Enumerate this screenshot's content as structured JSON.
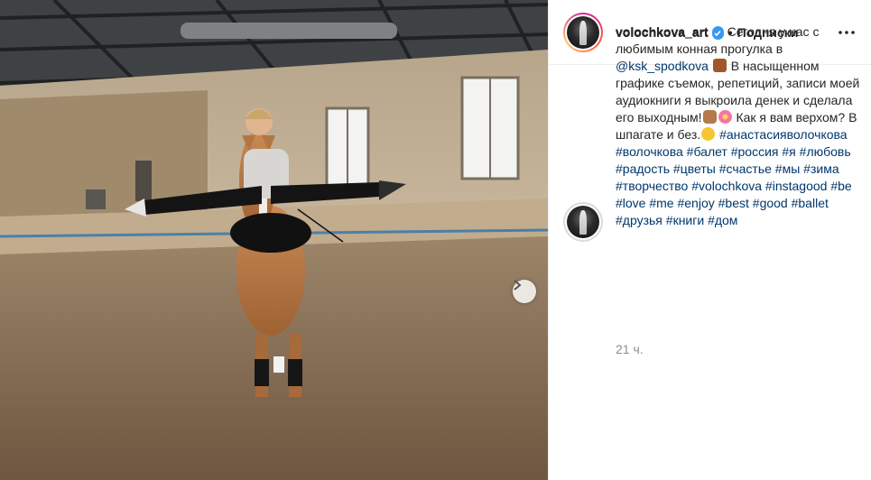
{
  "post": {
    "username": "volochkova_art",
    "separator": "•",
    "follow_label": "Подписки",
    "caption": {
      "username": "volochkova_art",
      "text_1": "Сегодня у нас с любимым конная прогулка в ",
      "mention": "@ksk_spodkova",
      "text_2": " В насыщенном графике съемок, репетиций, записи моей аудиокниги я выкроила денек и сделала его выходным!",
      "text_3": " Как я вам верхом? В шпагате и без.",
      "hashtags": [
        "#анастасияволочкова",
        "#волочкова",
        "#балет",
        "#россия",
        "#я",
        "#любовь",
        "#радость",
        "#цветы",
        "#счастье",
        "#мы",
        "#зима",
        "#творчество",
        "#volochkova",
        "#instagood",
        "#be",
        "#love",
        "#me",
        "#enjoy",
        "#best",
        "#good",
        "#ballet",
        "#друзья",
        "#книги",
        "#дом"
      ]
    },
    "timestamp": "21 ч."
  },
  "icons": {
    "verified": "verified-badge-icon",
    "more": "more-options-icon",
    "next": "chevron-right-icon",
    "emoji_horse": "horse-emoji",
    "emoji_thumbs": "thumbs-up-emoji",
    "emoji_flower": "flower-emoji",
    "emoji_laugh": "laughing-emoji"
  },
  "colors": {
    "link": "#00376b",
    "verified": "#3897f0",
    "muted": "#8e8e8e",
    "text": "#262626"
  }
}
